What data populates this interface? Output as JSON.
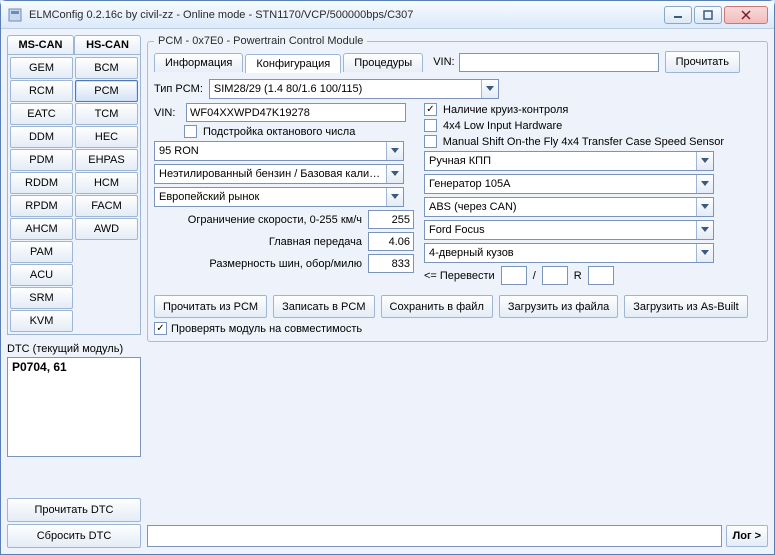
{
  "window": {
    "title": "ELMConfig 0.2.16c by civil-zz - Online mode - STN1170/VCP/500000bps/C307"
  },
  "leftpanel": {
    "bus_tabs": [
      "MS-CAN",
      "HS-CAN"
    ],
    "ms_can": [
      "GEM",
      "RCM",
      "EATC",
      "DDM",
      "PDM",
      "RDDM",
      "RPDM",
      "AHCM",
      "PAM",
      "ACU",
      "SRM",
      "KVM"
    ],
    "hs_can": [
      "BCM",
      "PCM",
      "TCM",
      "HEC",
      "EHPAS",
      "HCM",
      "FACM",
      "AWD"
    ],
    "active_module": "PCM",
    "dtc_label": "DTC (текущий модуль)",
    "dtc_value": "P0704, 61",
    "read_dtc": "Прочитать DTC",
    "reset_dtc": "Сбросить DTC"
  },
  "main": {
    "group_title": "PCM - 0x7E0 - Powertrain Control Module",
    "tabs": {
      "info": "Информация",
      "config": "Конфигурация",
      "proc": "Процедуры"
    },
    "active_tab": "config",
    "vin_label": "VIN:",
    "vin_top_value": "",
    "read_button": "Прочитать",
    "pcm_type_label": "Тип PCM:",
    "pcm_type_value": "SIM28/29 (1.4 80/1.6 100/115)",
    "vin2_label": "VIN:",
    "vin2_value": "WF04XXWPD47K19278",
    "octane_adjust_label": "Подстройка октанового числа",
    "octane_adjust_checked": false,
    "octane_select": "95 RON",
    "fuel_select": "Неэтилированный бензин / Базовая калибро",
    "market_select": "Европейский рынок",
    "speed_limit_label": "Ограничение скорости, 0-255 км/ч",
    "speed_limit_value": "255",
    "final_drive_label": "Главная передача",
    "final_drive_value": "4.06",
    "tire_size_label": "Размерность шин, обор/милю",
    "tire_size_value": "833",
    "right": {
      "cruise_label": "Наличие круиз-контроля",
      "cruise_checked": true,
      "low4x4_label": "4x4 Low Input Hardware",
      "low4x4_checked": false,
      "manual4x4_label": "Manual Shift On-the Fly 4x4 Transfer Case Speed Sensor",
      "manual4x4_checked": false,
      "trans_select": "Ручная КПП",
      "gen_select": "Генератор 105A",
      "abs_select": "ABS (через CAN)",
      "model_select": "Ford Focus",
      "body_select": "4-дверный кузов",
      "convert_label": "<= Перевести",
      "convert_v1": "",
      "convert_sep": "/",
      "convert_v2": "",
      "convert_r": "R",
      "convert_v3": ""
    },
    "buttons": {
      "read_pcm": "Прочитать из PCM",
      "write_pcm": "Записать в PCM",
      "save_file": "Сохранить в файл",
      "load_file": "Загрузить из файла",
      "load_asbuilt": "Загрузить из As-Built"
    },
    "compat_label": "Проверять модуль на совместимость",
    "compat_checked": true,
    "log_button": "Лог >"
  }
}
